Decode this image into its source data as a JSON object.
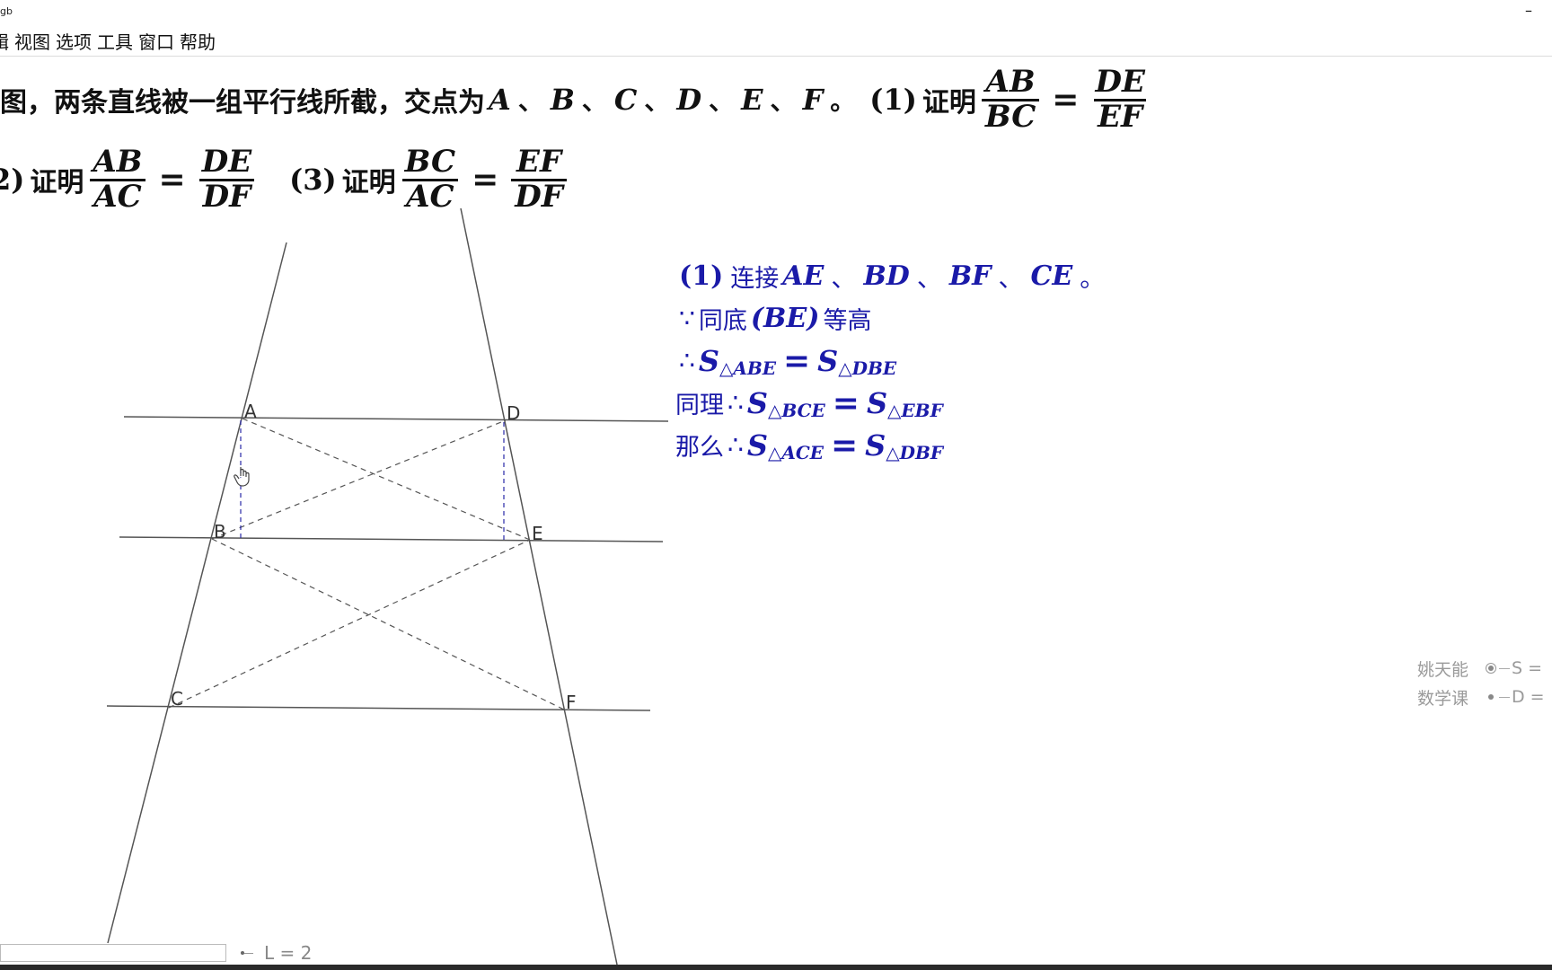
{
  "window": {
    "title": "gb",
    "minimize_label": "–"
  },
  "menu": {
    "items": [
      "辑",
      "视图",
      "选项",
      "工具",
      "窗口",
      "帮助"
    ]
  },
  "problem": {
    "line1_text": "图，两条直线被一组平行线所截，交点为",
    "points": [
      "A",
      "B",
      "C",
      "D",
      "E",
      "F"
    ],
    "separator": "、",
    "end_mark": "。",
    "part1_num": "(1)",
    "prove": "证明",
    "frac1": {
      "num": "AB",
      "den": "BC"
    },
    "frac2": {
      "num": "DE",
      "den": "EF"
    },
    "part2_num": "2)",
    "frac3": {
      "num": "AB",
      "den": "AC"
    },
    "frac4": {
      "num": "DE",
      "den": "DF"
    },
    "part3_num": "(3)",
    "frac5": {
      "num": "BC",
      "den": "AC"
    },
    "frac6": {
      "num": "EF",
      "den": "DF"
    },
    "equals": "="
  },
  "figure": {
    "labels": {
      "A": "A",
      "B": "B",
      "C": "C",
      "D": "D",
      "E": "E",
      "F": "F"
    }
  },
  "solution": {
    "l1_num": "(1)",
    "l1_text": "连接",
    "l1_segments": [
      "AE",
      "BD",
      "BF",
      "CE"
    ],
    "l1_sep": "、",
    "l1_end": "。",
    "l2_because": "∵",
    "l2_text1": "同底",
    "l2_paren": "(BE)",
    "l2_text2": "等高",
    "l3_therefore": "∴",
    "l3_lhs": "△ABE",
    "l3_rhs": "△DBE",
    "l4_prefix": "同理",
    "l4_therefore": "∴",
    "l4_lhs": "△BCE",
    "l4_rhs": "△EBF",
    "l5_prefix": "那么",
    "l5_therefore": "∴",
    "l5_lhs": "△ACE",
    "l5_rhs": "△DBF",
    "S": "S",
    "equals": "="
  },
  "sidebar": {
    "rows": [
      {
        "name": "姚天能",
        "eq": "S ="
      },
      {
        "name": "数学课",
        "eq": "D ="
      }
    ]
  },
  "slider": {
    "label": "L = 2"
  }
}
